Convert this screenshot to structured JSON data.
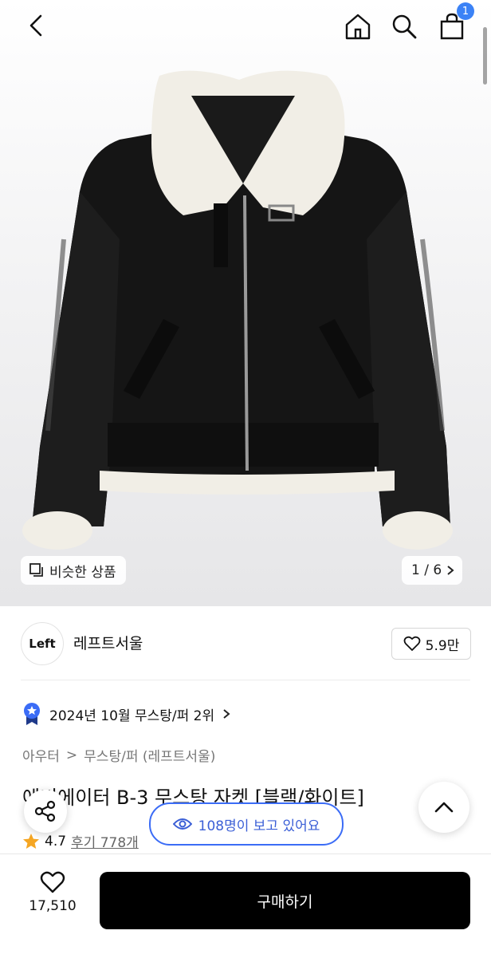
{
  "header": {
    "cart_count": "1"
  },
  "gallery": {
    "similar_label": "비슷한 상품",
    "counter": "1 / 6"
  },
  "seller": {
    "logo_text": "Left",
    "name": "레프트서울",
    "likes": "5.9만"
  },
  "rank": {
    "text": "2024년 10월 무스탕/퍼 2위"
  },
  "breadcrumb": {
    "level1": "아우터",
    "separator": ">",
    "level2": "무스탕/퍼 (레프트서울)"
  },
  "product": {
    "title": "에비에이터 B-3 무스탕 자켓 [블랙/화이트]",
    "rating": "4.7",
    "reviews": "후기 778개"
  },
  "viewers": {
    "text": "108명이 보고 있어요"
  },
  "bottom": {
    "wish_count": "17,510",
    "buy_label": "구매하기"
  },
  "colors": {
    "accent_blue": "#3b82f6",
    "buy_button": "#000000",
    "star": "#f5a623"
  },
  "icons": [
    "back-icon",
    "home-icon",
    "search-icon",
    "cart-icon",
    "similar-icon",
    "chevron-right-icon",
    "heart-icon",
    "rank-badge-icon",
    "share-icon",
    "chevron-up-icon",
    "eye-icon",
    "star-icon"
  ]
}
